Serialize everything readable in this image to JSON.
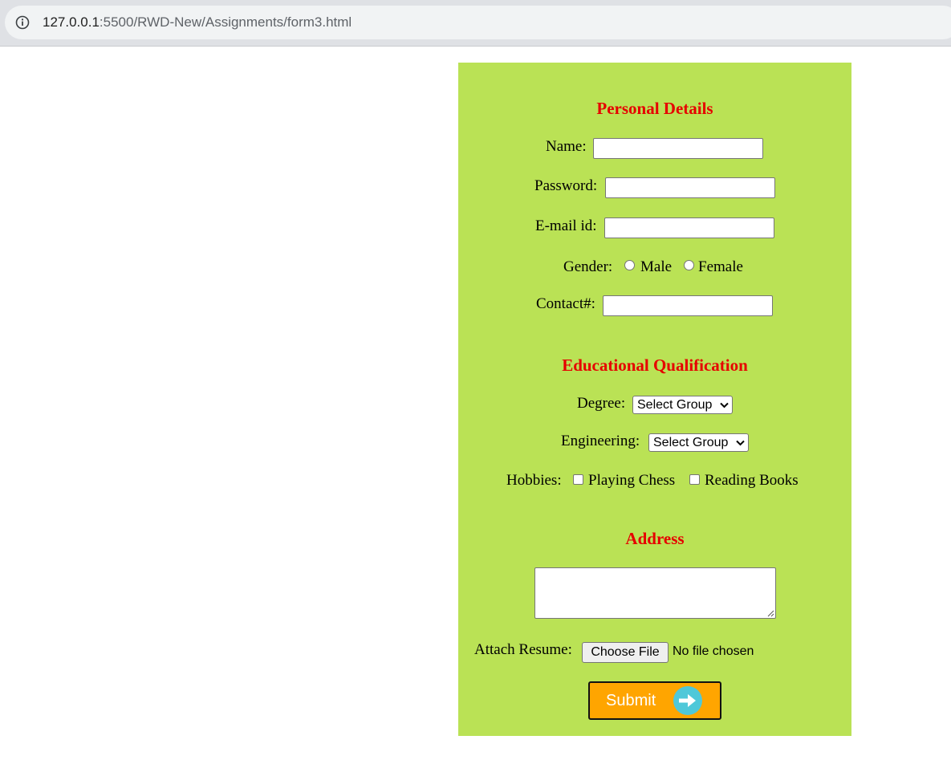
{
  "browser": {
    "url_host": "127.0.0.1",
    "url_rest": ":5500/RWD-New/Assignments/form3.html"
  },
  "personal": {
    "title": "Personal Details",
    "name_label": "Name:",
    "password_label": "Password:",
    "email_label": "E-mail id:",
    "gender_label": "Gender:",
    "gender_options": [
      "Male",
      "Female"
    ],
    "contact_label": "Contact#:"
  },
  "education": {
    "title": "Educational Qualification",
    "degree_label": "Degree:",
    "degree_value": "Select Group",
    "engineering_label": "Engineering:",
    "engineering_value": "Select Group",
    "hobbies_label": "Hobbies:",
    "hobby_options": [
      "Playing Chess",
      "Reading Books"
    ]
  },
  "address": {
    "title": "Address",
    "resume_label": "Attach Resume:",
    "file_button": "Choose File",
    "file_status": "No file chosen",
    "submit_label": "Submit"
  },
  "colors": {
    "panel_bg": "#bae255",
    "heading": "#e60000",
    "submit_bg": "#ffa500",
    "submit_icon": "#4fc8d9"
  },
  "icons": {
    "address_bar": "info-icon",
    "submit": "arrow-right-icon",
    "select": "chevron-down-icon"
  }
}
